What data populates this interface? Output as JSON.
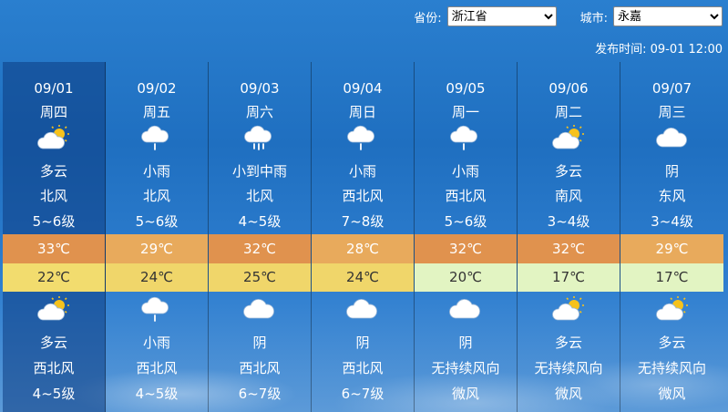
{
  "header": {
    "province_label": "省份:",
    "province_value": "浙江省",
    "city_label": "城市:",
    "city_value": "永嘉",
    "publish_label": "发布时间:",
    "publish_time": "09-01 12:00"
  },
  "days": [
    {
      "date": "09/01",
      "weekday": "周四",
      "day_icon": "partly-cloudy-icon",
      "day_cond": "多云",
      "day_wind": "北风",
      "day_power": "5~6级",
      "high": "33℃",
      "high_color": "#e0924e",
      "low": "22℃",
      "low_color": "#f2dc6e",
      "night_icon": "partly-cloudy-icon",
      "night_cond": "多云",
      "night_wind": "西北风",
      "night_power": "4~5级"
    },
    {
      "date": "09/02",
      "weekday": "周五",
      "day_icon": "light-rain-icon",
      "day_cond": "小雨",
      "day_wind": "北风",
      "day_power": "5~6级",
      "high": "29℃",
      "high_color": "#e8aa5c",
      "low": "24℃",
      "low_color": "#f0d66a",
      "night_icon": "light-rain-icon",
      "night_cond": "小雨",
      "night_wind": "西北风",
      "night_power": "4~5级"
    },
    {
      "date": "09/03",
      "weekday": "周六",
      "day_icon": "moderate-rain-icon",
      "day_cond": "小到中雨",
      "day_wind": "北风",
      "day_power": "4~5级",
      "high": "32℃",
      "high_color": "#e0924e",
      "low": "25℃",
      "low_color": "#f0d66a",
      "night_icon": "cloudy-icon",
      "night_cond": "阴",
      "night_wind": "西北风",
      "night_power": "6~7级"
    },
    {
      "date": "09/04",
      "weekday": "周日",
      "day_icon": "light-rain-icon",
      "day_cond": "小雨",
      "day_wind": "西北风",
      "day_power": "7~8级",
      "high": "28℃",
      "high_color": "#e8aa5c",
      "low": "24℃",
      "low_color": "#f0d66a",
      "night_icon": "cloudy-icon",
      "night_cond": "阴",
      "night_wind": "西北风",
      "night_power": "6~7级"
    },
    {
      "date": "09/05",
      "weekday": "周一",
      "day_icon": "light-rain-icon",
      "day_cond": "小雨",
      "day_wind": "西北风",
      "day_power": "5~6级",
      "high": "32℃",
      "high_color": "#e0924e",
      "low": "20℃",
      "low_color": "#e2f4c2",
      "night_icon": "cloudy-icon",
      "night_cond": "阴",
      "night_wind": "无持续风向",
      "night_power": "微风"
    },
    {
      "date": "09/06",
      "weekday": "周二",
      "day_icon": "partly-cloudy-icon",
      "day_cond": "多云",
      "day_wind": "南风",
      "day_power": "3~4级",
      "high": "32℃",
      "high_color": "#e0924e",
      "low": "17℃",
      "low_color": "#e2f4c2",
      "night_icon": "partly-cloudy-icon",
      "night_cond": "多云",
      "night_wind": "无持续风向",
      "night_power": "微风"
    },
    {
      "date": "09/07",
      "weekday": "周三",
      "day_icon": "cloudy-icon",
      "day_cond": "阴",
      "day_wind": "东风",
      "day_power": "3~4级",
      "high": "29℃",
      "high_color": "#e8aa5c",
      "low": "17℃",
      "low_color": "#e2f4c2",
      "night_icon": "partly-cloudy-icon",
      "night_cond": "多云",
      "night_wind": "无持续风向",
      "night_power": "微风"
    }
  ]
}
